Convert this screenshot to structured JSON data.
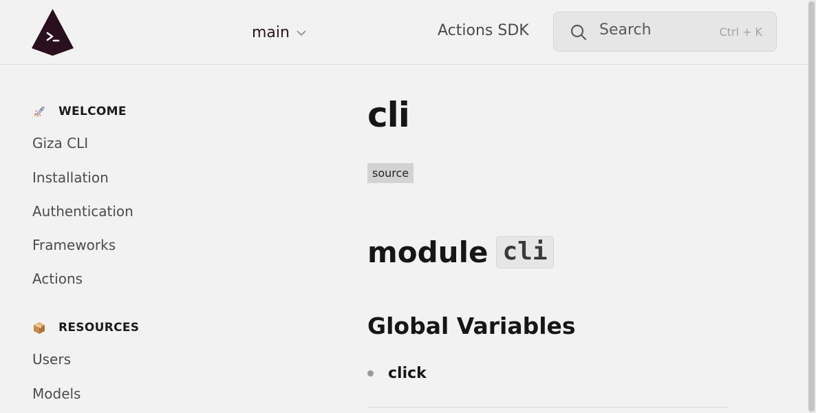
{
  "header": {
    "version_label": "main",
    "nav_link": "Actions SDK",
    "search": {
      "label": "Search",
      "shortcut": "Ctrl + K"
    }
  },
  "sidebar": {
    "sections": [
      {
        "icon": "rocket-emoji",
        "title": "WELCOME",
        "items": [
          "Giza CLI",
          "Installation",
          "Authentication",
          "Frameworks",
          "Actions"
        ]
      },
      {
        "icon": "package-emoji",
        "title": "RESOURCES",
        "items": [
          "Users",
          "Models"
        ]
      }
    ]
  },
  "main": {
    "title": "cli",
    "source_badge": "source",
    "module_heading": "module",
    "module_code": "cli",
    "global_vars_heading": "Global Variables",
    "variables": [
      "click"
    ]
  },
  "colors": {
    "brand": "#2a0f1e",
    "background": "#f2f2f2"
  }
}
